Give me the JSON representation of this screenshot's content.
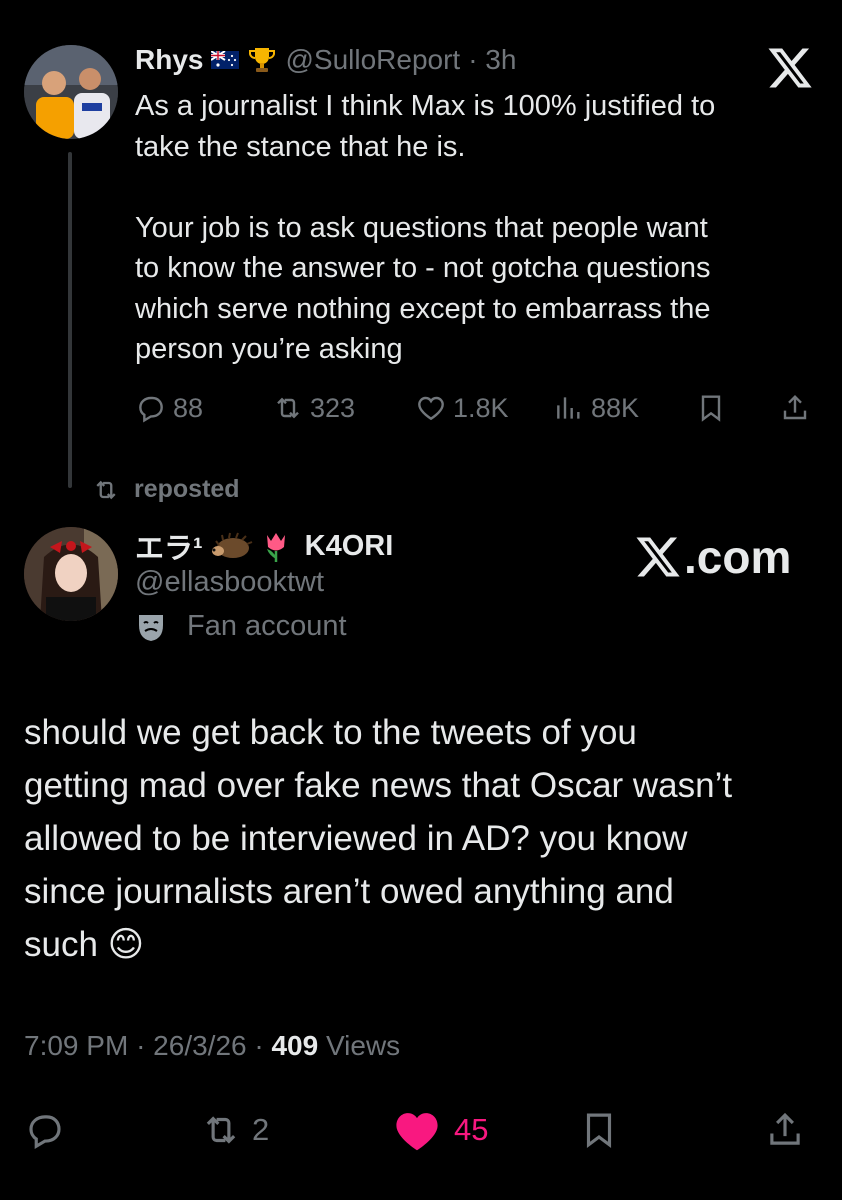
{
  "quoted": {
    "display_name": "Rhys",
    "handle": "@SulloReport",
    "time": "· 3h",
    "text": "As a journalist I think Max is 100% justified to\ntake the stance that he is.\n\nYour job is to ask questions that people want\nto know the answer to - not gotcha questions\nwhich serve nothing except to embarrass the\nperson you’re asking",
    "replies": "88",
    "reposts": "323",
    "likes": "1.8K",
    "views": "88K"
  },
  "repost_banner": "reposted",
  "tweet": {
    "display_name": "エラ¹",
    "name_suffix": "K4ORI",
    "handle": "@ellasbooktwt",
    "account_label": "Fan account",
    "text": "should we get back to the tweets of you\ngetting mad over fake news that Oscar wasn’t\nallowed to be interviewed in AD? you know\nsince journalists aren’t owed anything and\nsuch 😊",
    "time": "7:09 PM",
    "date": "26/3/26",
    "views_count": "409",
    "views_label": "Views",
    "reposts": "2",
    "likes": "45"
  },
  "watermark": ".com",
  "colors": {
    "background": "#000000",
    "text": "#e7e9ea",
    "muted": "#71767b",
    "like": "#f91880"
  },
  "icons": [
    "x-logo-icon",
    "reply-icon",
    "repost-icon",
    "like-icon",
    "views-icon",
    "bookmark-icon",
    "share-icon",
    "theater-mask-icon"
  ]
}
